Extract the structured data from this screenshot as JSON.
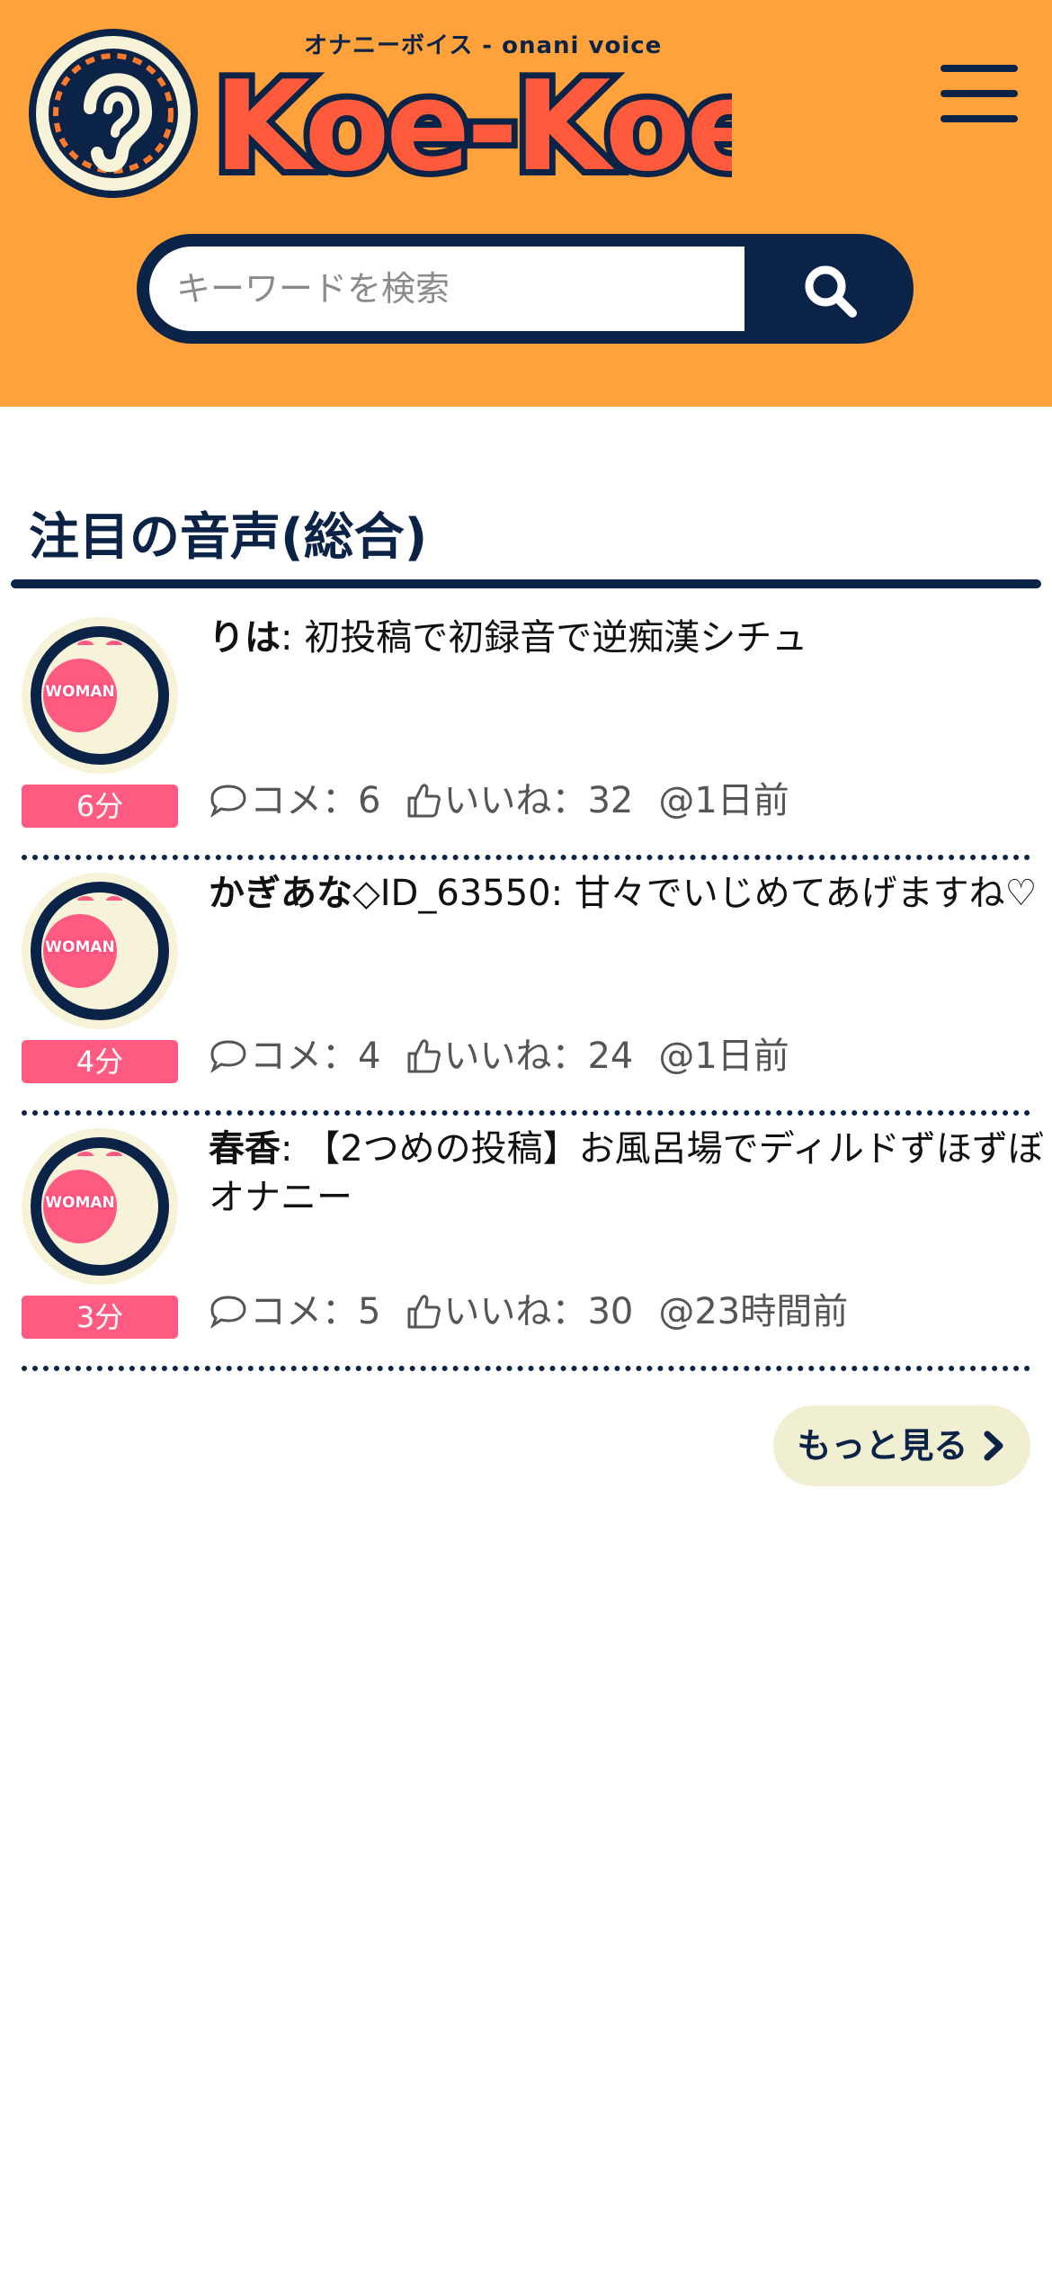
{
  "header": {
    "logo_subtitle": "オナニーボイス - onani voice",
    "logo_text": "Koe-Koe",
    "colors": {
      "background": "#ffa23b",
      "navy": "#0b2346",
      "accent": "#ff5b82"
    }
  },
  "search": {
    "placeholder": "キーワードを検索",
    "value": ""
  },
  "section": {
    "title": "注目の音声(総合)"
  },
  "items": [
    {
      "avatar_label": "WOMAN",
      "duration": "6分",
      "author": "りは",
      "separator": ": ",
      "title": "初投稿で初録音で逆痴漢シチュ",
      "comments": "コメ：6",
      "likes": "いいね：32",
      "posted": "@1日前"
    },
    {
      "avatar_label": "WOMAN",
      "duration": "4分",
      "author": "かぎあな",
      "separator": "◇ID_63550: ",
      "title": "甘々でいじめてあげますね♡",
      "comments": "コメ：4",
      "likes": "いいね：24",
      "posted": "@1日前"
    },
    {
      "avatar_label": "WOMAN",
      "duration": "3分",
      "author": "春香",
      "separator": ": ",
      "title": "【2つめの投稿】お風呂場でディルドずほずぼオナニー",
      "comments": "コメ：5",
      "likes": "いいね：30",
      "posted": "@23時間前"
    }
  ],
  "more_button": {
    "label": "もっと見る",
    "icon": "chevron-right-icon"
  },
  "icons": [
    "ear-logo-icon",
    "menu-icon",
    "search-icon",
    "speech-bubble-icon",
    "thumbs-up-icon",
    "chevron-right-icon"
  ]
}
